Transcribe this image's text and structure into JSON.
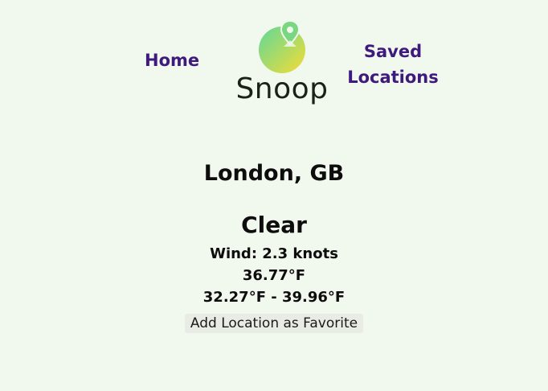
{
  "nav": {
    "home_label": "Home",
    "saved_label_line1": "Saved",
    "saved_label_line2": "Locations"
  },
  "brand": {
    "name": "Snoop",
    "logo_icon": "map-pin-circle-icon",
    "logo_gradient": [
      "#5fd89a",
      "#f2d93a"
    ]
  },
  "weather": {
    "location": "London, GB",
    "condition": "Clear",
    "wind": "Wind: 2.3 knots",
    "temperature": "36.77°F",
    "range": "32.27°F - 39.96°F"
  },
  "actions": {
    "favorite_label": "Add Location as Favorite"
  },
  "colors": {
    "background": "#f1f8ee",
    "nav_link": "#3f1a7d",
    "button_bg": "#e8ece5"
  }
}
